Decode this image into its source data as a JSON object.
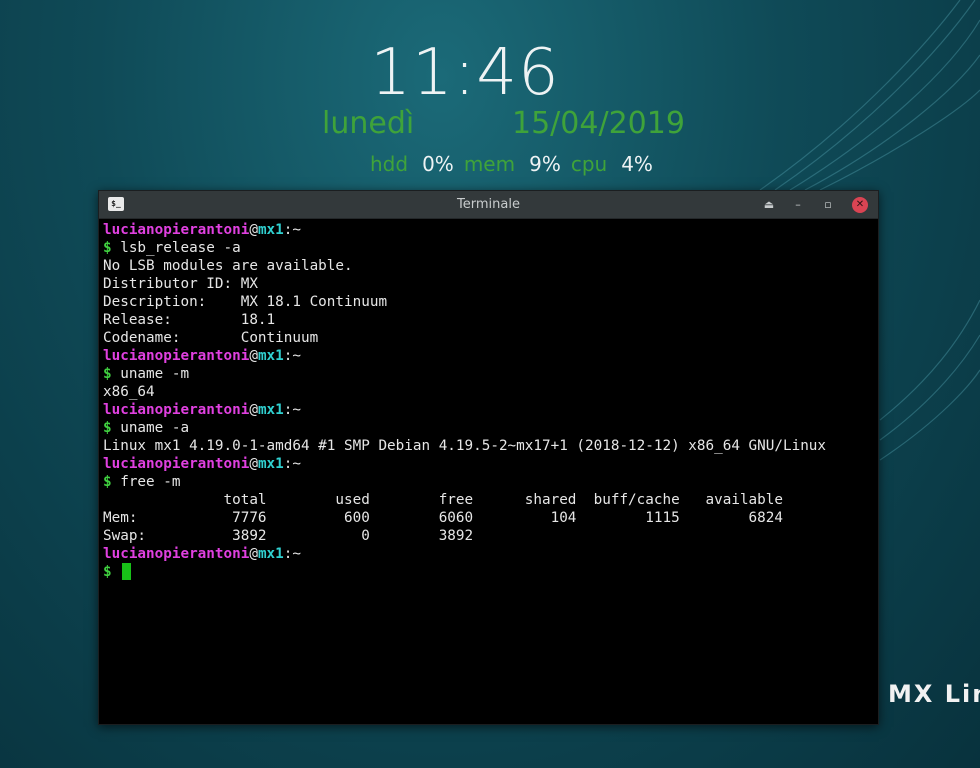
{
  "desktop": {
    "clock": {
      "time": "11:46",
      "day": "lunedì",
      "date": "15/04/2019"
    },
    "stats": [
      {
        "label": "hdd",
        "value": "0%"
      },
      {
        "label": "mem",
        "value": "9%"
      },
      {
        "label": "cpu",
        "value": "4%"
      }
    ],
    "logo": "MX Linux"
  },
  "terminal": {
    "title": "Terminale",
    "icon": "terminal-icon",
    "user": "lucianopierantoni",
    "at": "@",
    "host": "mx1",
    "path": ":~",
    "prompt_symbol": "$",
    "blocks": [
      {
        "command": "lsb_release -a",
        "output": [
          "No LSB modules are available.",
          "Distributor ID: MX",
          "Description:    MX 18.1 Continuum",
          "Release:        18.1",
          "Codename:       Continuum"
        ]
      },
      {
        "command": "uname -m",
        "output": [
          "x86_64"
        ]
      },
      {
        "command": "uname -a",
        "output": [
          "Linux mx1 4.19.0-1-amd64 #1 SMP Debian 4.19.5-2~mx17+1 (2018-12-12) x86_64 GNU/Linux"
        ]
      },
      {
        "command": "free -m",
        "output": [
          "              total        used        free      shared  buff/cache   available",
          "Mem:           7776         600        6060         104        1115        6824",
          "Swap:          3892           0        3892"
        ]
      }
    ]
  },
  "colors": {
    "accent_green": "#3fa33a",
    "prompt_user": "#e040e0",
    "prompt_host": "#30d0d0",
    "prompt_dollar": "#40d040",
    "close_button": "#da4453"
  }
}
